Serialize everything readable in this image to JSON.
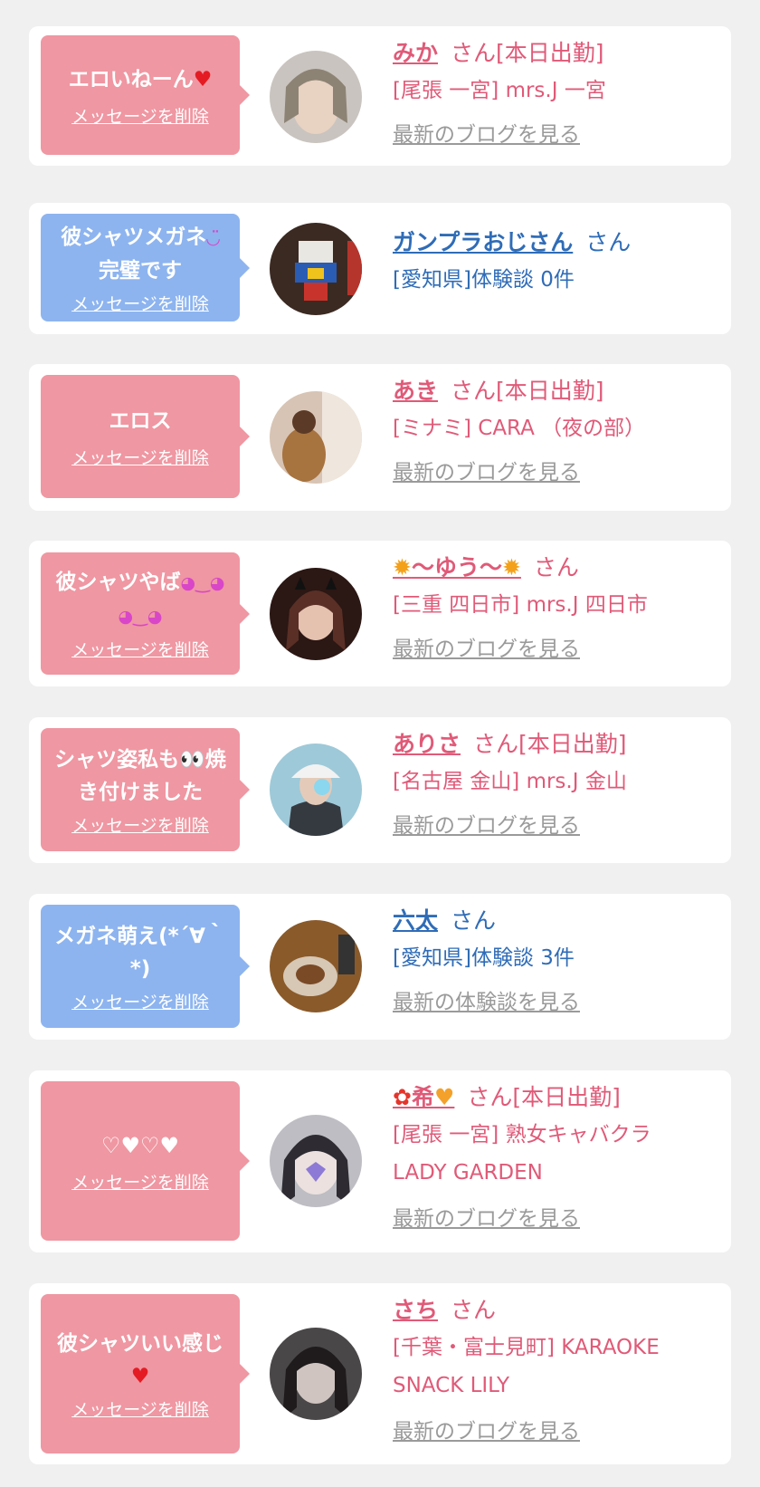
{
  "common": {
    "delete_label": "メッセージを削除",
    "san": "さん"
  },
  "cards": [
    {
      "message": "エロいねーん",
      "message_emoji": "heart-red",
      "name": "みか",
      "suffix": "さん[本日出勤]",
      "detail": "[尾張 一宮] mrs.J 一宮",
      "link": "最新のブログを見る"
    },
    {
      "message": "彼シャツメガネ",
      "message_line2": "完璧です",
      "message_emoji": "smiley",
      "name": "ガンプラおじさん",
      "suffix": "さん",
      "detail": "[愛知県]体験談 0件"
    },
    {
      "message": "エロス",
      "name": "あき",
      "suffix": "さん[本日出勤]",
      "detail": "[ミナミ] CARA （夜の部）",
      "link": "最新のブログを見る"
    },
    {
      "message": "彼シャツやば",
      "message_emoji": "starry-eyes",
      "name": "〜ゆう〜",
      "name_emoji": "sunflower",
      "suffix": "さん",
      "detail": "[三重 四日市] mrs.J 四日市",
      "link": "最新のブログを見る"
    },
    {
      "message": "シャツ姿私も",
      "message_mid_emoji": "eyes",
      "message_after": "焼",
      "message_line2": "き付けました",
      "name": "ありさ",
      "suffix": "さん[本日出勤]",
      "detail": "[名古屋 金山] mrs.J 金山",
      "link": "最新のブログを見る"
    },
    {
      "message": "メガネ萌え(*´∀｀",
      "message_line2": "*)",
      "name": "六太",
      "suffix": "さん",
      "detail": "[愛知県]体験談 3件",
      "link": "最新の体験談を見る"
    },
    {
      "message": "♡♥♡♥",
      "name": "希",
      "name_prefix_emoji": "flower",
      "name_emoji": "heart-orange",
      "suffix": "さん[本日出勤]",
      "detail": "[尾張 一宮] 熟女キャバクラ",
      "detail2": "LADY GARDEN",
      "link": "最新のブログを見る"
    },
    {
      "message": "彼シャツいい感じ",
      "message_emoji": "heart-red",
      "name": "さち",
      "suffix": "さん",
      "detail": "[千葉・富士見町] KARAOKE",
      "detail2": "SNACK LILY",
      "link": "最新のブログを見る"
    }
  ],
  "colors": {
    "page_bg": "#f0f0f0",
    "bubble_pink": "#ef97a2",
    "bubble_blue": "#8db4ef",
    "text_pink": "#e05a78",
    "text_blue": "#2f6cb7",
    "link_gray": "#9a9a9a"
  }
}
